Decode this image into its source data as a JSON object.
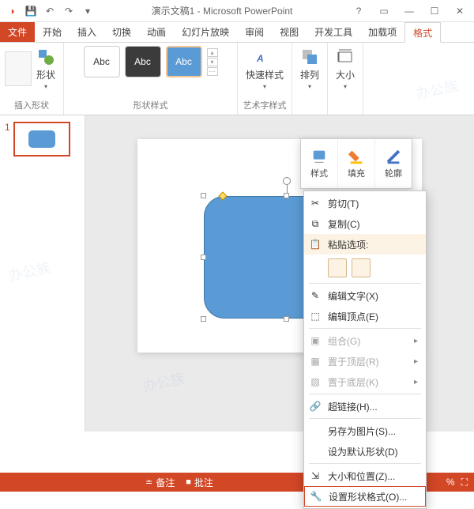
{
  "title": "演示文稿1 - Microsoft PowerPoint",
  "tabs": {
    "file": "文件",
    "start": "开始",
    "insert": "插入",
    "trans": "切换",
    "anim": "动画",
    "show": "幻灯片放映",
    "review": "审阅",
    "view": "视图",
    "dev": "开发工具",
    "addin": "加载项",
    "format": "格式"
  },
  "ribbon": {
    "insert_shapes": "插入形状",
    "shapes_btn": "形状",
    "shape_styles": "形状样式",
    "abc": "Abc",
    "wordart": "艺术字样式",
    "quick_style": "快速样式",
    "arrange": "排列",
    "size": "大小"
  },
  "thumb_index": "1",
  "mini": {
    "style": "样式",
    "fill": "填充",
    "outline": "轮廓"
  },
  "context": {
    "cut": "剪切(T)",
    "copy": "复制(C)",
    "paste_label": "粘贴选项:",
    "edit_text": "编辑文字(X)",
    "edit_points": "编辑顶点(E)",
    "group": "组合(G)",
    "bring_front": "置于顶层(R)",
    "send_back": "置于底层(K)",
    "hyperlink": "超链接(H)...",
    "save_as_pic": "另存为图片(S)...",
    "set_default": "设为默认形状(D)",
    "size_pos": "大小和位置(Z)...",
    "format_shape": "设置形状格式(O)..."
  },
  "status": {
    "notes": "备注",
    "comments": "批注",
    "pct": "%"
  }
}
